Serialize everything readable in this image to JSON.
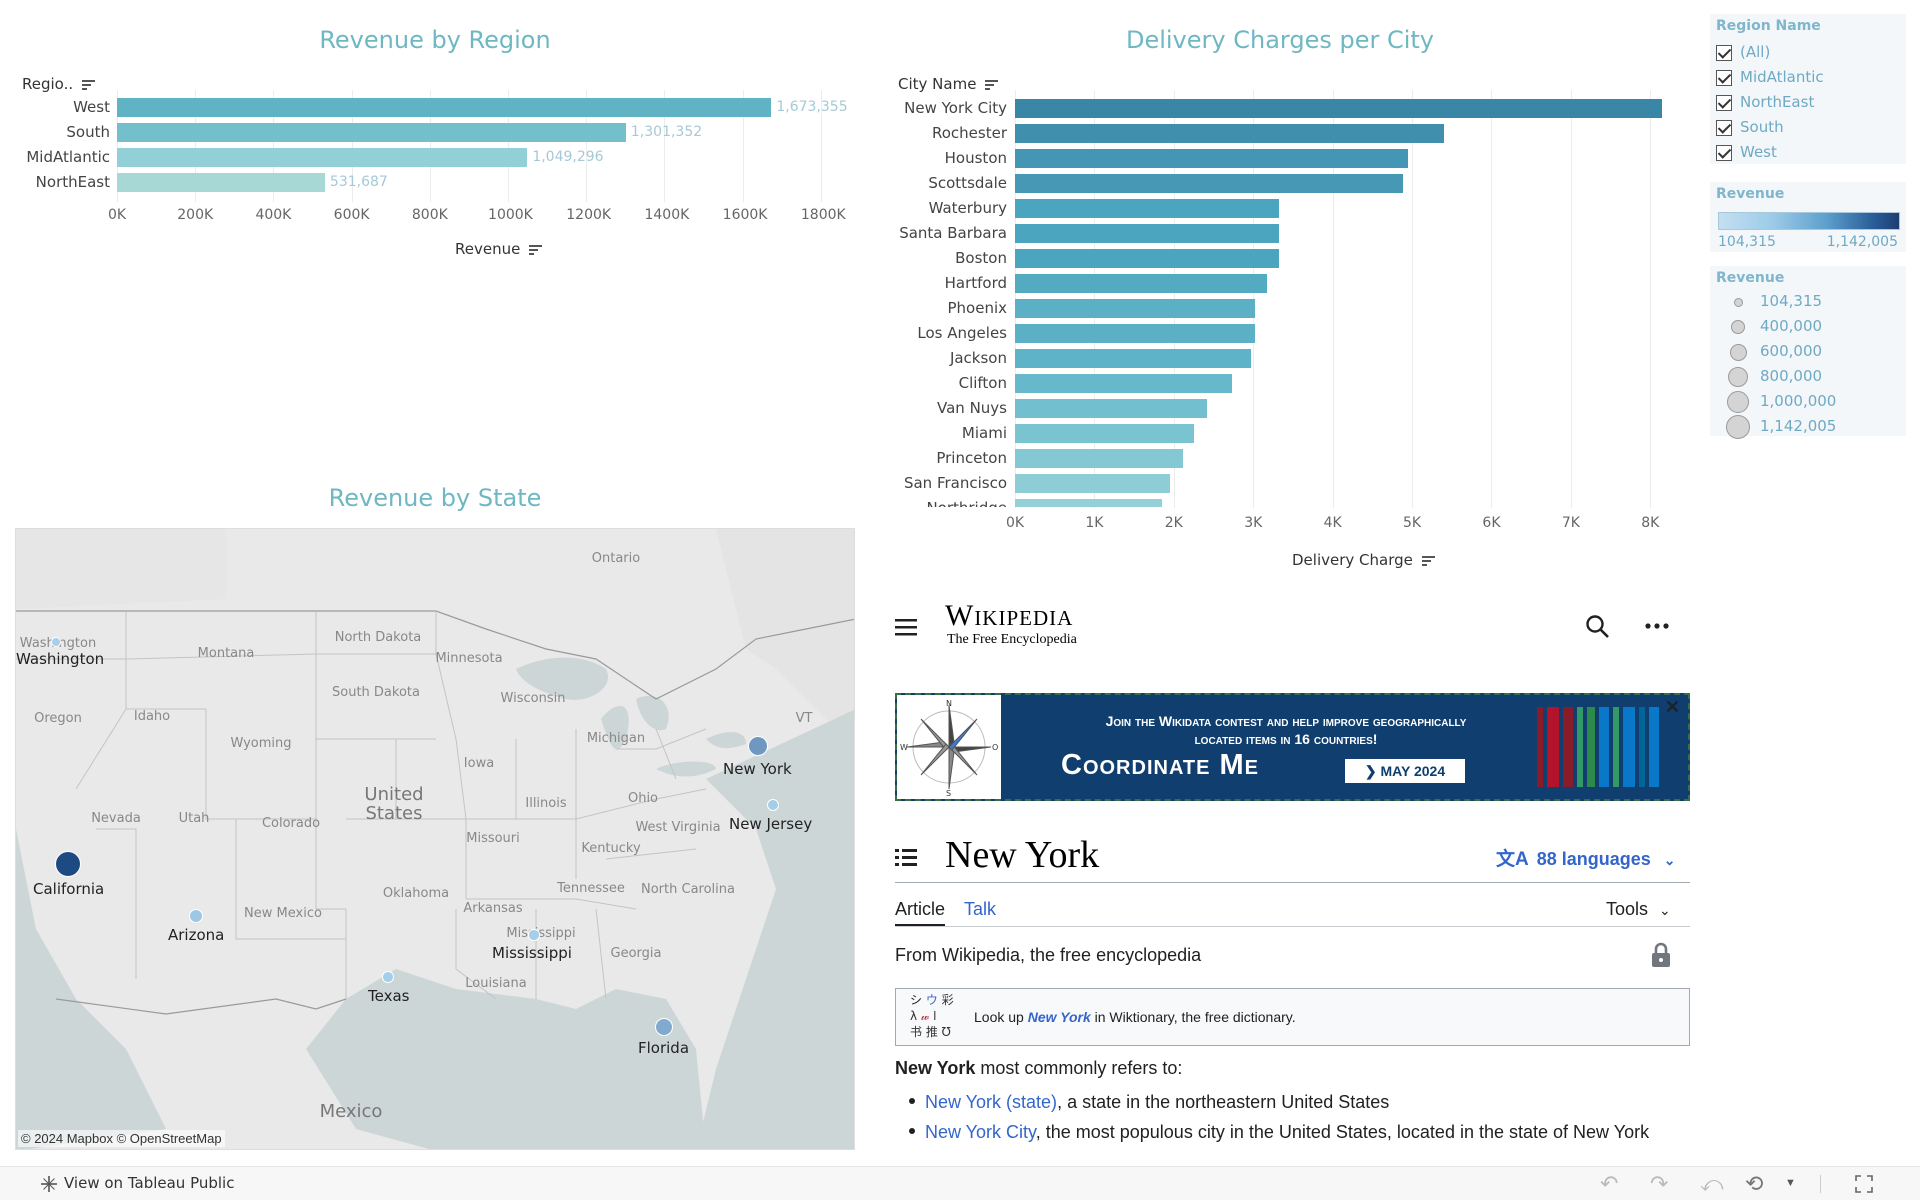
{
  "region_chart": {
    "title": "Revenue by Region",
    "y_header": "Regio..",
    "x_axis_label": "Revenue",
    "ticks": [
      "0K",
      "200K",
      "400K",
      "600K",
      "800K",
      "1000K",
      "1200K",
      "1400K",
      "1600K",
      "1800K"
    ],
    "colors": [
      "#5fb3c4",
      "#74bfcc",
      "#92cfd6",
      "#a8d8d6"
    ]
  },
  "city_chart": {
    "title": "Delivery Charges per City",
    "y_header": "City Name",
    "x_axis_label": "Delivery Charge",
    "ticks": [
      "0K",
      "1K",
      "2K",
      "3K",
      "4K",
      "5K",
      "6K",
      "7K",
      "8K"
    ],
    "partial_label": "Northridge"
  },
  "chart_data": [
    {
      "type": "bar",
      "title": "Revenue by Region",
      "categories": [
        "West",
        "South",
        "MidAtlantic",
        "NorthEast"
      ],
      "values": [
        1673355,
        1301352,
        1049296,
        531687
      ],
      "value_labels": [
        "1,673,355",
        "1,301,352",
        "1,049,296",
        "531,687"
      ],
      "xlabel": "Revenue",
      "ylabel": "Regio..",
      "xlim": [
        0,
        1900000
      ],
      "grid": true
    },
    {
      "type": "bar",
      "title": "Delivery Charges per City",
      "categories": [
        "New York City",
        "Rochester",
        "Houston",
        "Scottsdale",
        "Waterbury",
        "Santa Barbara",
        "Boston",
        "Hartford",
        "Phoenix",
        "Los Angeles",
        "Jackson",
        "Clifton",
        "Van Nuys",
        "Miami",
        "Princeton",
        "San Francisco"
      ],
      "values": [
        8150,
        5400,
        4950,
        4880,
        3320,
        3320,
        3320,
        3170,
        3020,
        3020,
        2970,
        2730,
        2420,
        2250,
        2120,
        1950
      ],
      "xlabel": "Delivery Charge",
      "ylabel": "City Name",
      "xlim": [
        0,
        8500
      ],
      "grid": true
    }
  ],
  "legend": {
    "region_title": "Region Name",
    "regions": [
      "(All)",
      "MidAtlantic",
      "NorthEast",
      "South",
      "West"
    ],
    "color_title": "Revenue",
    "color_min": "104,315",
    "color_max": "1,142,005",
    "size_title": "Revenue",
    "sizes": [
      "104,315",
      "400,000",
      "600,000",
      "800,000",
      "1,000,000",
      "1,142,005"
    ]
  },
  "map": {
    "title": "Revenue by State",
    "attribution": "© 2024 Mapbox  © OpenStreetMap",
    "geo_labels": [
      "Washington",
      "Montana",
      "North Dakota",
      "South Dakota",
      "Minnesota",
      "Oregon",
      "Idaho",
      "Wyoming",
      "Wisconsin",
      "Michigan",
      "Iowa",
      "Nevada",
      "Utah",
      "Colorado",
      "United States",
      "Illinois",
      "Ohio",
      "Missouri",
      "Kentucky",
      "West Virginia",
      "New Mexico",
      "Oklahoma",
      "Arkansas",
      "Tennessee",
      "North Carolina",
      "Mississippi",
      "Georgia",
      "Louisiana",
      "Mexico",
      "Ontario",
      "VT"
    ],
    "states": [
      {
        "name": "California",
        "revenue": 1142005
      },
      {
        "name": "New York",
        "revenue": 530000
      },
      {
        "name": "Florida",
        "revenue": 390000
      },
      {
        "name": "Arizona",
        "revenue": 170000
      },
      {
        "name": "New Jersey",
        "revenue": 120000
      },
      {
        "name": "Mississippi",
        "revenue": 110000
      },
      {
        "name": "Texas",
        "revenue": 115000
      },
      {
        "name": "Washington",
        "revenue": 104315
      }
    ]
  },
  "wiki": {
    "logo_title": "Wikipedia",
    "logo_tagline": "The Free Encyclopedia",
    "banner_line1": "Join the Wikidata contest and help improve geographically",
    "banner_line2": "located items in 16 countries!",
    "banner_brand": "Coordinate Me",
    "banner_date": "❯ MAY 2024",
    "page_title": "New York",
    "languages": "88 languages",
    "tab_article": "Article",
    "tab_talk": "Talk",
    "tools": "Tools",
    "from": "From Wikipedia, the free encyclopedia",
    "wiktionary_pre": "Look up ",
    "wiktionary_term": "New York",
    "wiktionary_post": " in Wiktionary, the free dictionary.",
    "lead_bold": "New York",
    "lead_rest": " most commonly refers to:",
    "items": [
      {
        "link": "New York (state)",
        "rest": ", a state in the northeastern United States"
      },
      {
        "link": "New York City",
        "rest": ", the most populous city in the United States, located in the state of New York"
      }
    ]
  },
  "footer": {
    "view_label": "View on Tableau Public"
  }
}
